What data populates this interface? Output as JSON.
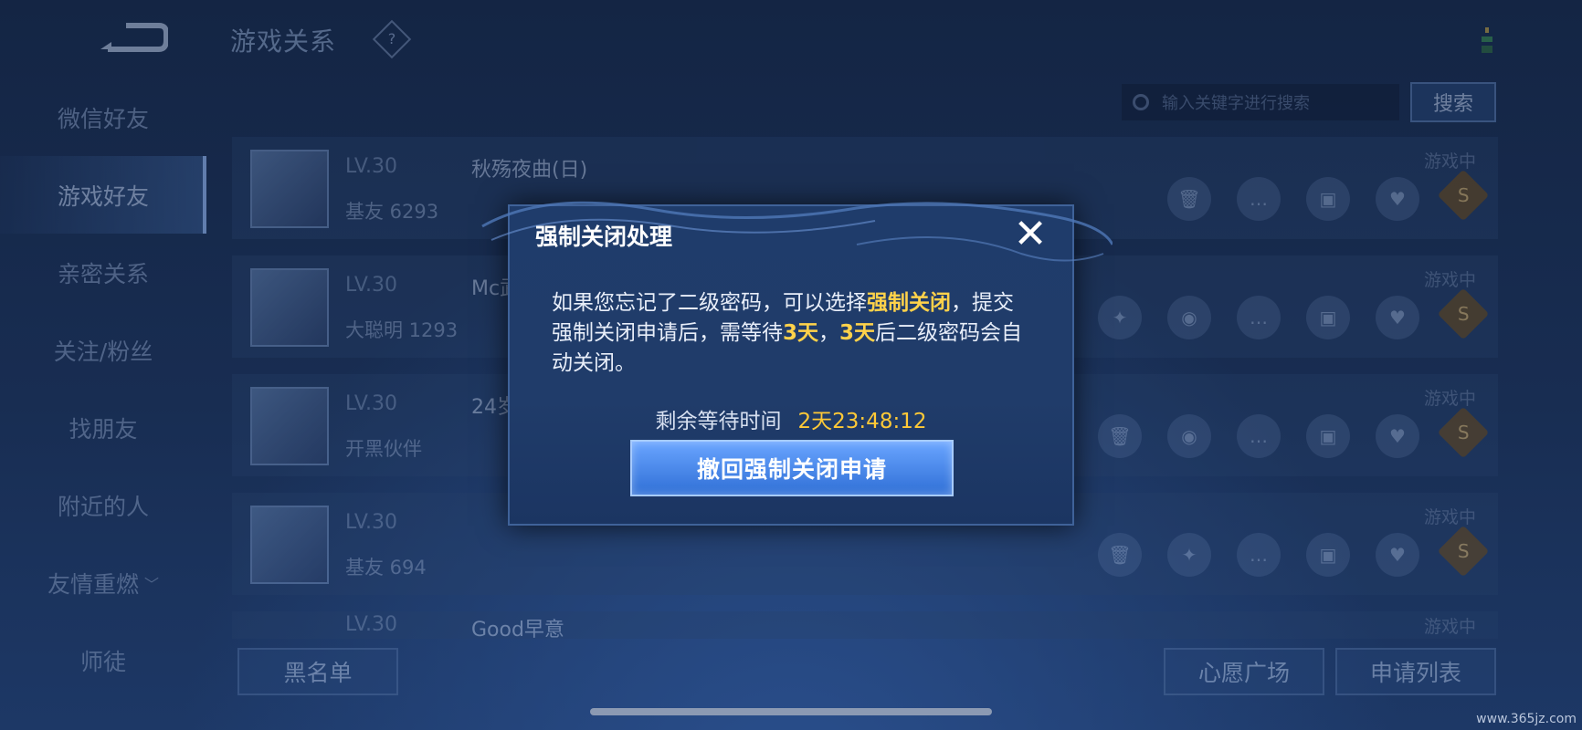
{
  "header": {
    "title": "游戏关系",
    "help": "?"
  },
  "sidebar": {
    "items": [
      {
        "label": "微信好友"
      },
      {
        "label": "游戏好友",
        "active": true
      },
      {
        "label": "亲密关系"
      },
      {
        "label": "关注/粉丝"
      },
      {
        "label": "找朋友"
      },
      {
        "label": "附近的人"
      },
      {
        "label": "友情重燃",
        "chevron": "﹀"
      },
      {
        "label": "师徒"
      }
    ]
  },
  "search": {
    "placeholder": "输入关键字进行搜索",
    "button": "搜索"
  },
  "friends": [
    {
      "level": "LV.30",
      "name": "秋殇夜曲(日)",
      "relation": "基友 6293",
      "status": "游戏中"
    },
    {
      "level": "LV.30",
      "name": "Mc武",
      "relation": "大聪明 1293",
      "status": "游戏中"
    },
    {
      "level": "LV.30",
      "name": "24岁",
      "relation": "开黑伙伴",
      "status": "游戏中"
    },
    {
      "level": "LV.30",
      "name": "",
      "relation": "基友 694",
      "status": "游戏中"
    },
    {
      "level": "LV.30",
      "name": "Good早意",
      "relation": "",
      "status": "游戏中"
    }
  ],
  "bottom": {
    "blacklist": "黑名单",
    "wish_square": "心愿广场",
    "request_list": "申请列表"
  },
  "watermark": "www.365jz.com",
  "modal": {
    "title": "强制关闭处理",
    "close": "✕",
    "text_1": "如果您忘记了二级密码，可以选择",
    "text_hl_1": "强制关闭",
    "text_2": "，提交强制关闭申请后，需等待",
    "text_hl_2": "3天",
    "text_3": "，",
    "text_hl_3": "3天",
    "text_4": "后二级密码会自动关闭。",
    "wait_label": "剩余等待时间",
    "wait_time": "2天23:48:12",
    "revoke_button": "撤回强制关闭申请"
  },
  "colors": {
    "highlight": "#ffd24a",
    "accent": "#3f7ee0",
    "bg": "#142544"
  }
}
